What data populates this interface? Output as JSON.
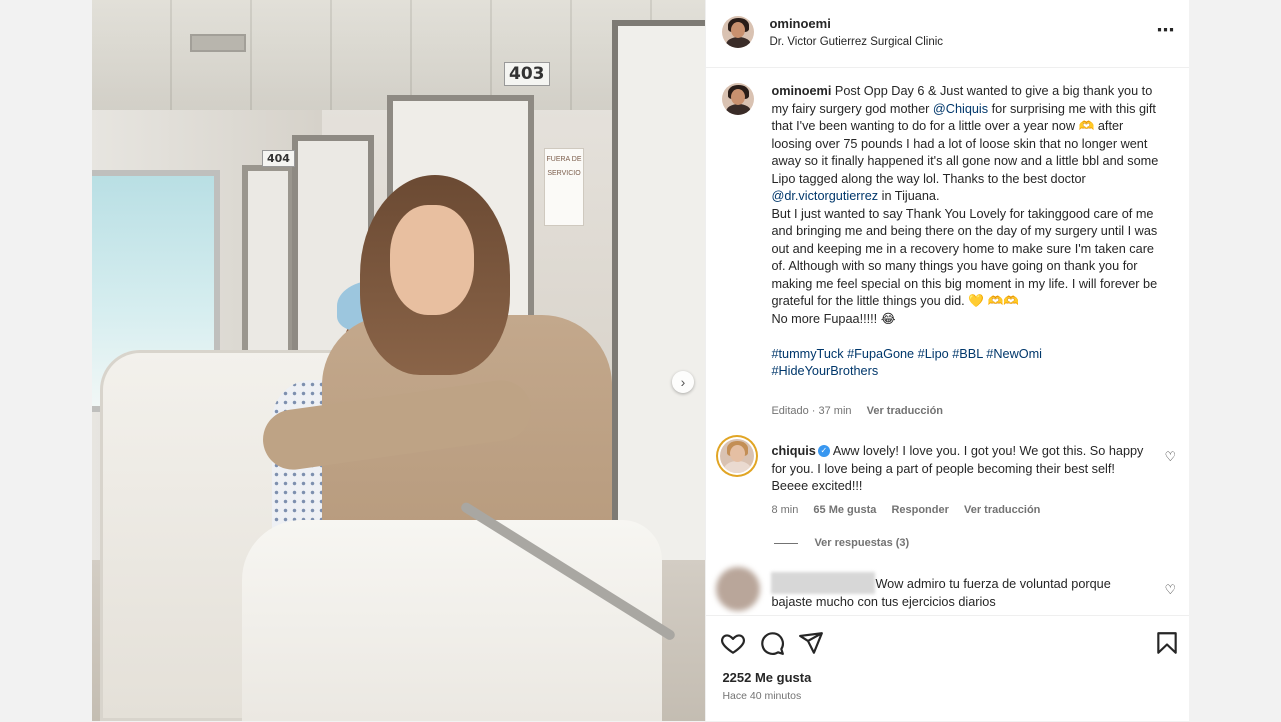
{
  "post": {
    "username": "ominoemi",
    "location": "Dr. Victor Gutierrez Surgical Clinic",
    "more_icon": "⋯"
  },
  "photo": {
    "room_number_403": "403",
    "room_number_404": "404",
    "sign_text": "FUERA DE SERVICIO",
    "next_icon": "›"
  },
  "caption": {
    "username": "ominoemi",
    "text_1": " Post Opp Day 6 & Just wanted to give a big thank you to my fairy surgery god mother ",
    "mention_1": "@Chiquis",
    "text_2": " for surprising me with this gift that I've been wanting to do for a little over a year now 🫶 after loosing over 75 pounds I had a lot of loose skin that no longer went away so it finally happened it's all gone now and a little bbl and some Lipo tagged along the way lol. Thanks to the best doctor ",
    "mention_2": "@dr.victorgutierrez",
    "text_3": " in Tijuana.",
    "text_4": "But I just wanted to say Thank You Lovely for takinggood care of me and bringing me and being there on the day of my surgery until I was out and keeping me in a recovery home to make sure I'm taken care of. Although with so many things you have going on thank you for making me feel special on this big moment in my life. I will forever be grateful for the little things you did. 💛 🫶🫶",
    "text_5": "No more Fupaa!!!!! 😂",
    "hashtags_line_1": "#tummyTuck #FupaGone #Lipo #BBL #NewOmi",
    "hashtags_line_2": "#HideYourBrothers",
    "edited": "Editado · 37 min",
    "see_translation": "Ver traducción"
  },
  "comment_1": {
    "username": "chiquis",
    "verified_icon": "✓",
    "text": "Aww lovely! I love you. I got you! We got this. So happy for you. I love being a part of people becoming their best self! Beeee excited!!!",
    "time": "8 min",
    "likes": "65 Me gusta",
    "reply": "Responder",
    "see_translation": "Ver traducción",
    "view_replies": "Ver respuestas (3)"
  },
  "comment_2": {
    "text": "Wow admiro tu fuerza de voluntad porque bajaste mucho con tus ejercicios diarios"
  },
  "actions": {
    "like_count": "2252 Me gusta",
    "time_ago": "Hace 40 minutos"
  },
  "icons": {
    "heart": "heart-icon",
    "comment": "comment-icon",
    "share": "send-icon",
    "save": "bookmark-icon"
  },
  "colors": {
    "link": "#00376b",
    "muted": "#737373",
    "text": "#262626",
    "verified": "#3897f0"
  }
}
